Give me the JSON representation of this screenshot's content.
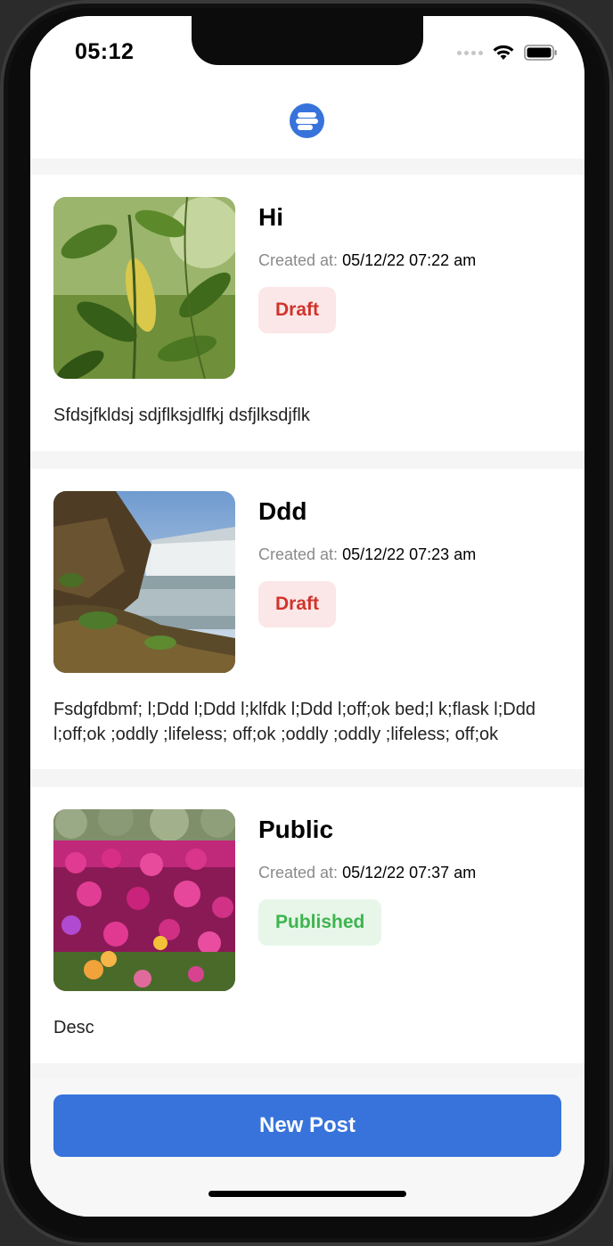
{
  "status_bar": {
    "time": "05:12"
  },
  "header": {
    "logo_icon": "app-logo-icon"
  },
  "posts": [
    {
      "title": "Hi",
      "created_label": "Created at:",
      "created_value": "05/12/22 07:22 am",
      "status": "Draft",
      "description": "Sfdsjfkldsj sdjflksjdlfkj dsfjlksdjflk",
      "image": "leaves-photo"
    },
    {
      "title": "Ddd",
      "created_label": "Created at:",
      "created_value": "05/12/22 07:23 am",
      "status": "Draft",
      "description": "Fsdgfdbmf; l;Ddd l;Ddd l;klfdk l;Ddd l;off;ok bed;l k;flask l;Ddd l;off;ok ;oddly ;lifeless; off;ok ;oddly ;oddly ;lifeless; off;ok",
      "image": "waterfall-photo"
    },
    {
      "title": "Public",
      "created_label": "Created at:",
      "created_value": "05/12/22 07:37 am",
      "status": "Published",
      "description": "Desc",
      "image": "flowers-photo"
    }
  ],
  "footer": {
    "new_post_label": "New Post"
  },
  "colors": {
    "accent": "#3773db",
    "draft_text": "#d0342c",
    "draft_bg": "#fbe7e7",
    "published_text": "#3fb44f",
    "published_bg": "#e7f6e9"
  }
}
